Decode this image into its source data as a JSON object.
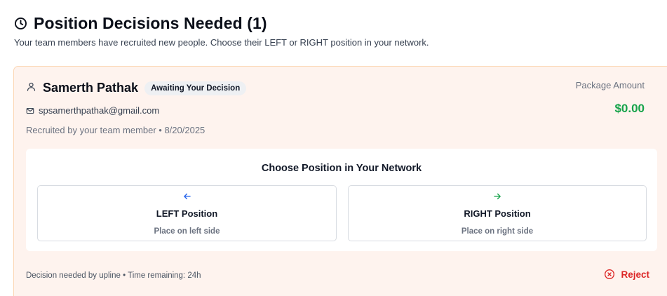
{
  "header": {
    "title": "Position Decisions Needed (1)",
    "subtitle": "Your team members have recruited new people. Choose their LEFT or RIGHT position in your network."
  },
  "card": {
    "name": "Samerth Pathak",
    "status_badge": "Awaiting Your Decision",
    "email": "spsamerthpathak@gmail.com",
    "recruited_by": "Recruited by your team member • 8/20/2025",
    "package_label": "Package Amount",
    "package_value": "$0.00",
    "choose_title": "Choose Position in Your Network",
    "left": {
      "label": "LEFT Position",
      "description": "Place on left side",
      "icon": "arrow-left-icon"
    },
    "right": {
      "label": "RIGHT Position",
      "description": "Place on right side",
      "icon": "arrow-right-icon"
    },
    "footer_note": "Decision needed by upline • Time remaining: 24h",
    "reject_label": "Reject"
  },
  "colors": {
    "card_bg": "#fef3ee",
    "card_border": "#fcd7b5",
    "package_green": "#16a34a",
    "left_arrow_blue": "#2563eb",
    "right_arrow_green": "#16a34a",
    "reject_red": "#dc2626"
  }
}
